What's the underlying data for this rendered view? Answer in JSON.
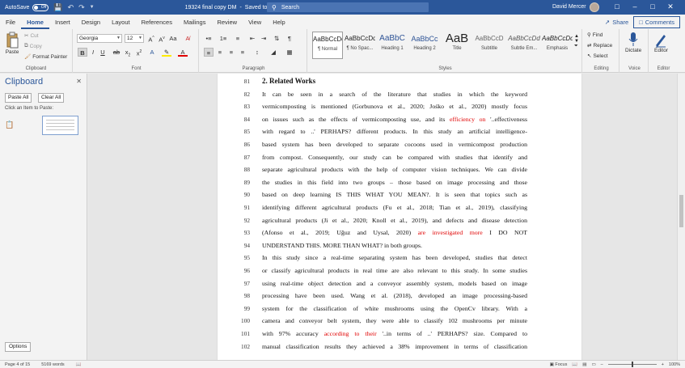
{
  "titlebar": {
    "autosave_label": "AutoSave",
    "autosave_state": "Off",
    "doc_title": "19324 final copy DM",
    "save_status": "Saved to this PC",
    "search_placeholder": "Search",
    "user_name": "David Mercer"
  },
  "tabs": [
    {
      "label": "File"
    },
    {
      "label": "Home"
    },
    {
      "label": "Insert"
    },
    {
      "label": "Design"
    },
    {
      "label": "Layout"
    },
    {
      "label": "References"
    },
    {
      "label": "Mailings"
    },
    {
      "label": "Review"
    },
    {
      "label": "View"
    },
    {
      "label": "Help"
    }
  ],
  "share_label": "Share",
  "comments_label": "Comments",
  "ribbon": {
    "clipboard": {
      "paste": "Paste",
      "cut": "Cut",
      "copy": "Copy",
      "format_painter": "Format Painter",
      "group_label": "Clipboard"
    },
    "font": {
      "font_name": "Georgia",
      "font_size": "12",
      "group_label": "Font"
    },
    "paragraph": {
      "group_label": "Paragraph"
    },
    "styles": {
      "items": [
        {
          "sample": "AaBbCcDd",
          "label": "¶ Normal"
        },
        {
          "sample": "AaBbCcDd",
          "label": "¶ No Spac..."
        },
        {
          "sample": "AaBbC",
          "label": "Heading 1"
        },
        {
          "sample": "AaBbCc",
          "label": "Heading 2"
        },
        {
          "sample": "AaB",
          "label": "Title"
        },
        {
          "sample": "AaBbCcD",
          "label": "Subtitle"
        },
        {
          "sample": "AaBbCcDd",
          "label": "Subtle Em..."
        },
        {
          "sample": "AaBbCcDd",
          "label": "Emphasis"
        }
      ],
      "group_label": "Styles"
    },
    "editing": {
      "find": "Find",
      "replace": "Replace",
      "select": "Select",
      "group_label": "Editing"
    },
    "voice": {
      "dictate": "Dictate",
      "group_label": "Voice"
    },
    "editor": {
      "editor": "Editor",
      "group_label": "Editor"
    }
  },
  "clipboard_pane": {
    "title": "Clipboard",
    "paste_all": "Paste All",
    "clear_all": "Clear All",
    "hint": "Click an Item to Paste:",
    "options": "Options"
  },
  "document": {
    "lines": [
      {
        "n": "81",
        "segments": [
          {
            "t": "2.  Related Works",
            "red": false
          }
        ],
        "heading": true
      },
      {
        "n": "82",
        "segments": [
          {
            "t": "It can be seen in a search of the literature that studies in which the keyword",
            "red": false
          }
        ]
      },
      {
        "n": "83",
        "segments": [
          {
            "t": "vermicomposting is mentioned (Gorbunova et al., 2020; Jośko et al., 2020) mostly focus",
            "red": false
          }
        ]
      },
      {
        "n": "84",
        "segments": [
          {
            "t": "on issues such as the effects of vermicomposting use, and its ",
            "red": false
          },
          {
            "t": "efficiency on ",
            "red": true
          },
          {
            "t": "'..effectiveness",
            "red": false
          }
        ]
      },
      {
        "n": "85",
        "segments": [
          {
            "t": "with regard to ..' PERHAPS? different products. In this study an artificial intelligence-",
            "red": false
          }
        ]
      },
      {
        "n": "86",
        "segments": [
          {
            "t": "based system has been developed to separate cocoons used in vermicompost production",
            "red": false
          }
        ]
      },
      {
        "n": "87",
        "segments": [
          {
            "t": "from compost. Consequently, our study can be compared with studies that identify and",
            "red": false
          }
        ]
      },
      {
        "n": "88",
        "segments": [
          {
            "t": "separate agricultural products with the help of computer vision techniques. We can divide",
            "red": false
          }
        ]
      },
      {
        "n": "89",
        "segments": [
          {
            "t": "the studies in this field into two groups – those based on image processing and those",
            "red": false
          }
        ]
      },
      {
        "n": "90",
        "segments": [
          {
            "t": "based on deep learning IS THIS WHAT YOU MEAN?. It is seen that topics such as",
            "red": false
          }
        ]
      },
      {
        "n": "91",
        "segments": [
          {
            "t": "identifying different agricultural products (Fu et al., 2018; Tian et al., 2019), classifying",
            "red": false
          }
        ]
      },
      {
        "n": "92",
        "segments": [
          {
            "t": "agricultural products (Ji et al., 2020; Knoll et al., 2019), and defects and disease detection",
            "red": false
          }
        ]
      },
      {
        "n": "93",
        "segments": [
          {
            "t": "(Afonso et al., 2019; Uğuz and Uysal, 2020) ",
            "red": false
          },
          {
            "t": "are investigated more",
            "red": true
          },
          {
            "t": " I DO NOT",
            "red": false
          }
        ]
      },
      {
        "n": "94",
        "segments": [
          {
            "t": "UNDERSTAND THIS.  MORE THAN WHAT? in both groups.",
            "red": false
          }
        ],
        "last": true
      },
      {
        "n": "95",
        "segments": [
          {
            "t": "In this study since a real-time separating system has been developed, studies that detect",
            "red": false
          }
        ]
      },
      {
        "n": "96",
        "segments": [
          {
            "t": "or classify agricultural products in real time are also relevant to this study. In some studies",
            "red": false
          }
        ]
      },
      {
        "n": "97",
        "segments": [
          {
            "t": "using real-time object detection and a conveyor assembly system, models based on image",
            "red": false
          }
        ]
      },
      {
        "n": "98",
        "segments": [
          {
            "t": "processing have been used. Wang et al. (2018), developed an image processing-based",
            "red": false
          }
        ]
      },
      {
        "n": "99",
        "segments": [
          {
            "t": "system for the classification of white mushrooms using the OpenCv library. With a",
            "red": false
          }
        ]
      },
      {
        "n": "100",
        "segments": [
          {
            "t": "camera and conveyor belt system, they were able to classify 102 mushrooms per minute",
            "red": false
          }
        ]
      },
      {
        "n": "101",
        "segments": [
          {
            "t": "with 97% accuracy ",
            "red": false
          },
          {
            "t": "according to their",
            "red": true
          },
          {
            "t": " '..in terms of ..' PERHAPS? size. Compared to",
            "red": false
          }
        ]
      },
      {
        "n": "102",
        "segments": [
          {
            "t": "manual classification results they achieved a 38% improvement in terms of classification",
            "red": false
          }
        ]
      }
    ]
  },
  "statusbar": {
    "page": "Page 4 of 15",
    "words": "5169 words",
    "focus": "Focus",
    "zoom": "100%"
  },
  "colors": {
    "accent": "#2b579a",
    "revision_red": "#e00000"
  }
}
